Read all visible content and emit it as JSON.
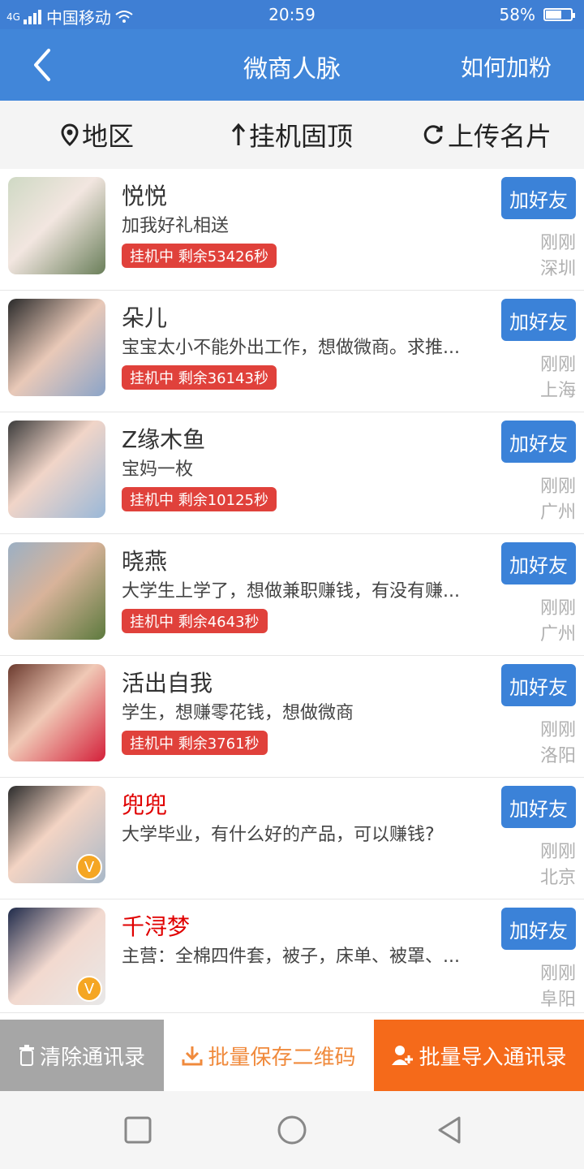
{
  "status": {
    "network": "4G",
    "carrier": "中国移动",
    "time": "20:59",
    "battery": "58%",
    "battery_level": 0.58,
    "wifi_icon": "wifi-icon"
  },
  "header": {
    "title": "微商人脉",
    "howto": "如何加粉"
  },
  "filters": {
    "region": "地区",
    "pin": "挂机固顶",
    "upload": "上传名片"
  },
  "items": [
    {
      "name": "悦悦",
      "desc": "加我好礼相送",
      "badge": "挂机中 剩余53426秒",
      "btn": "加好友",
      "time": "刚刚",
      "city": "深圳",
      "vip": false
    },
    {
      "name": "朵儿",
      "desc": "宝宝太小不能外出工作，想做微商。求推...",
      "badge": "挂机中 剩余36143秒",
      "btn": "加好友",
      "time": "刚刚",
      "city": "上海",
      "vip": false
    },
    {
      "name": "Z缘木鱼",
      "desc": "宝妈一枚",
      "badge": "挂机中 剩余10125秒",
      "btn": "加好友",
      "time": "刚刚",
      "city": "广州",
      "vip": false
    },
    {
      "name": "晓燕",
      "desc": "大学生上学了，想做兼职赚钱，有没有赚...",
      "badge": "挂机中 剩余4643秒",
      "btn": "加好友",
      "time": "刚刚",
      "city": "广州",
      "vip": false
    },
    {
      "name": "活出自我",
      "desc": "学生，想赚零花钱，想做微商",
      "badge": "挂机中 剩余3761秒",
      "btn": "加好友",
      "time": "刚刚",
      "city": "洛阳",
      "vip": false
    },
    {
      "name": "兜兜",
      "desc": "大学毕业，有什么好的产品，可以赚钱?",
      "badge": "",
      "btn": "加好友",
      "time": "刚刚",
      "city": "北京",
      "vip": true,
      "v": "V"
    },
    {
      "name": "千浔梦",
      "desc": "主营：全棉四件套，被子，床单、被罩、...",
      "badge": "",
      "btn": "加好友",
      "time": "刚刚",
      "city": "阜阳",
      "vip": true,
      "v": "V"
    }
  ],
  "bottom": {
    "clear": "清除通讯录",
    "save": "批量保存二维码",
    "import": "批量导入通讯录"
  },
  "colors": {
    "primary": "#4186d9",
    "badge": "#e0413b",
    "vipName": "#e00000",
    "orange": "#f56a1a"
  }
}
